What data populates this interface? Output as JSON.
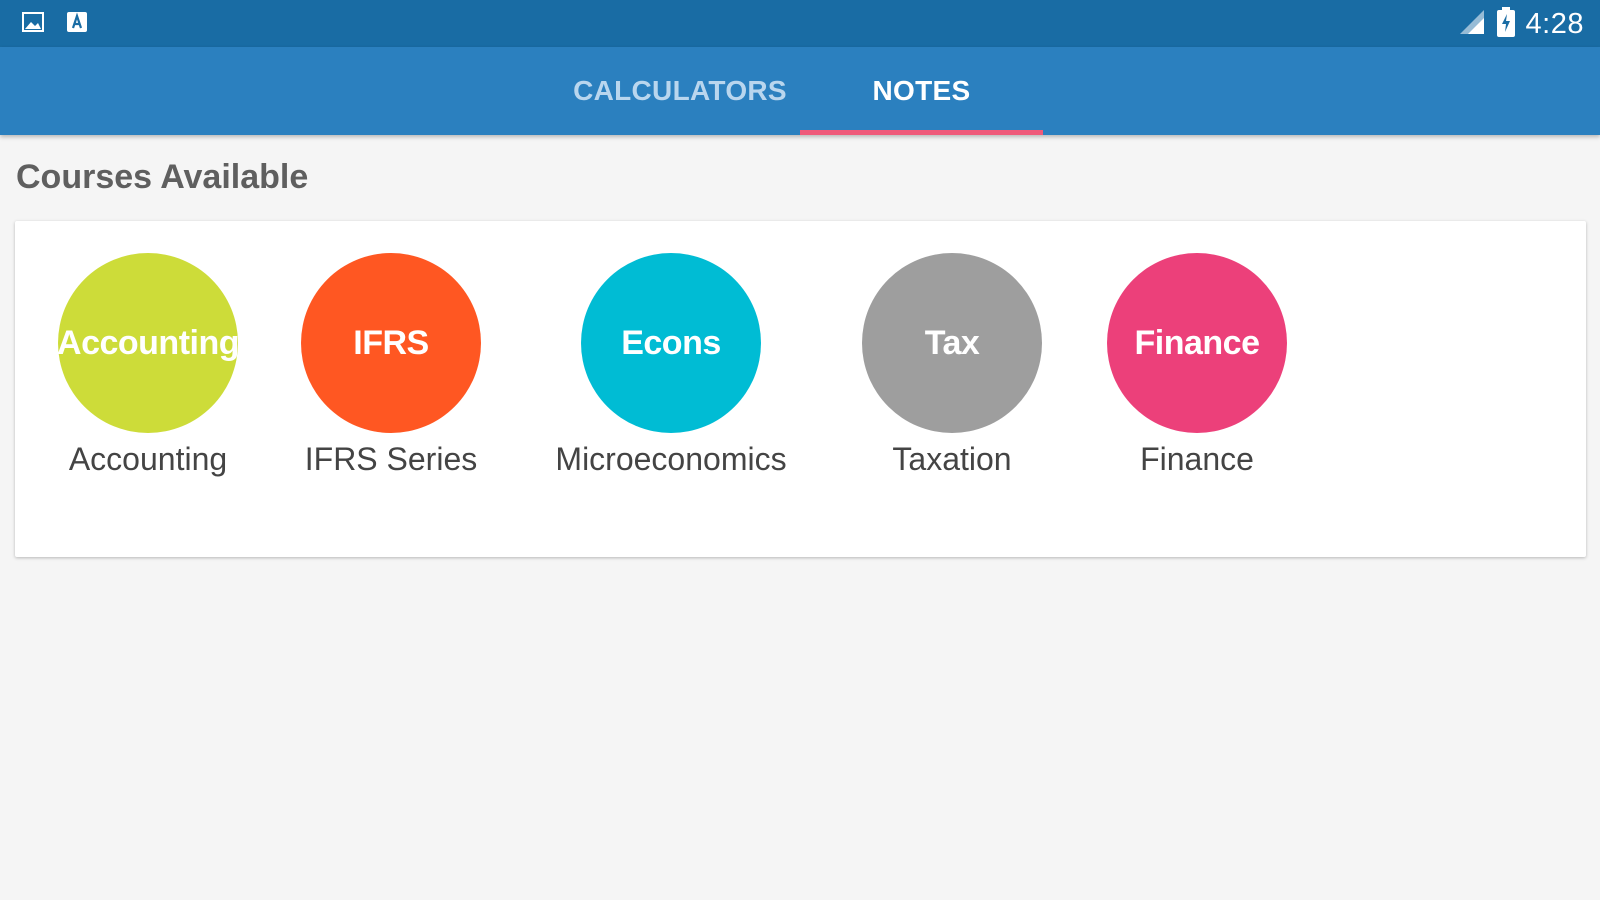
{
  "status_bar": {
    "left_icons": [
      "image-icon",
      "a-icon"
    ],
    "time": "4:28",
    "right_icons": [
      "signal-icon",
      "battery-icon"
    ]
  },
  "tabs": [
    {
      "label": "CALCULATORS",
      "selected": false
    },
    {
      "label": "NOTES",
      "selected": true
    }
  ],
  "colors": {
    "status_bar": "#196ca4",
    "tab_bar": "#2b80bf",
    "tab_indicator": "#ef5a7a",
    "background": "#f5f5f5"
  },
  "section_title": "Courses Available",
  "courses": [
    {
      "badge": "Accounting",
      "label": "Accounting",
      "color": "#cddc39"
    },
    {
      "badge": "IFRS",
      "label": "IFRS Series",
      "color": "#ff5722"
    },
    {
      "badge": "Econs",
      "label": "Microeconomics",
      "color": "#00bcd4"
    },
    {
      "badge": "Tax",
      "label": "Taxation",
      "color": "#9e9e9e"
    },
    {
      "badge": "Finance",
      "label": "Finance",
      "color": "#ec407a"
    }
  ]
}
